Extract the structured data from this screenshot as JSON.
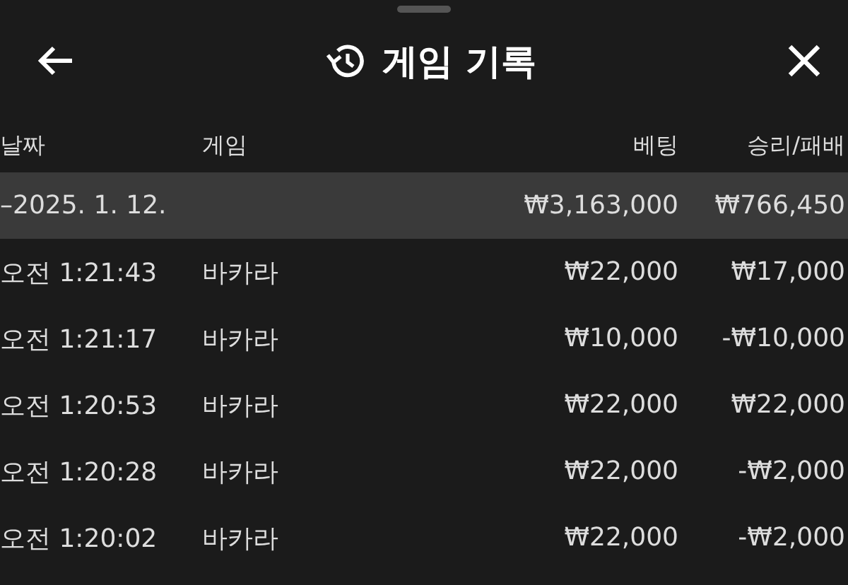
{
  "header": {
    "title": "게임 기록"
  },
  "table": {
    "columns": [
      "날짜",
      "게임",
      "베팅",
      "승리/패배"
    ],
    "group": {
      "date": "–2025. 1. 12.",
      "bet": "₩3,163,000",
      "result": "₩766,450"
    },
    "rows": [
      {
        "time": "오전 1:21:43",
        "game": "바카라",
        "bet": "₩22,000",
        "result": "₩17,000"
      },
      {
        "time": "오전 1:21:17",
        "game": "바카라",
        "bet": "₩10,000",
        "result": "-₩10,000"
      },
      {
        "time": "오전 1:20:53",
        "game": "바카라",
        "bet": "₩22,000",
        "result": "₩22,000"
      },
      {
        "time": "오전 1:20:28",
        "game": "바카라",
        "bet": "₩22,000",
        "result": "-₩2,000"
      },
      {
        "time": "오전 1:20:02",
        "game": "바카라",
        "bet": "₩22,000",
        "result": "-₩2,000"
      }
    ]
  }
}
